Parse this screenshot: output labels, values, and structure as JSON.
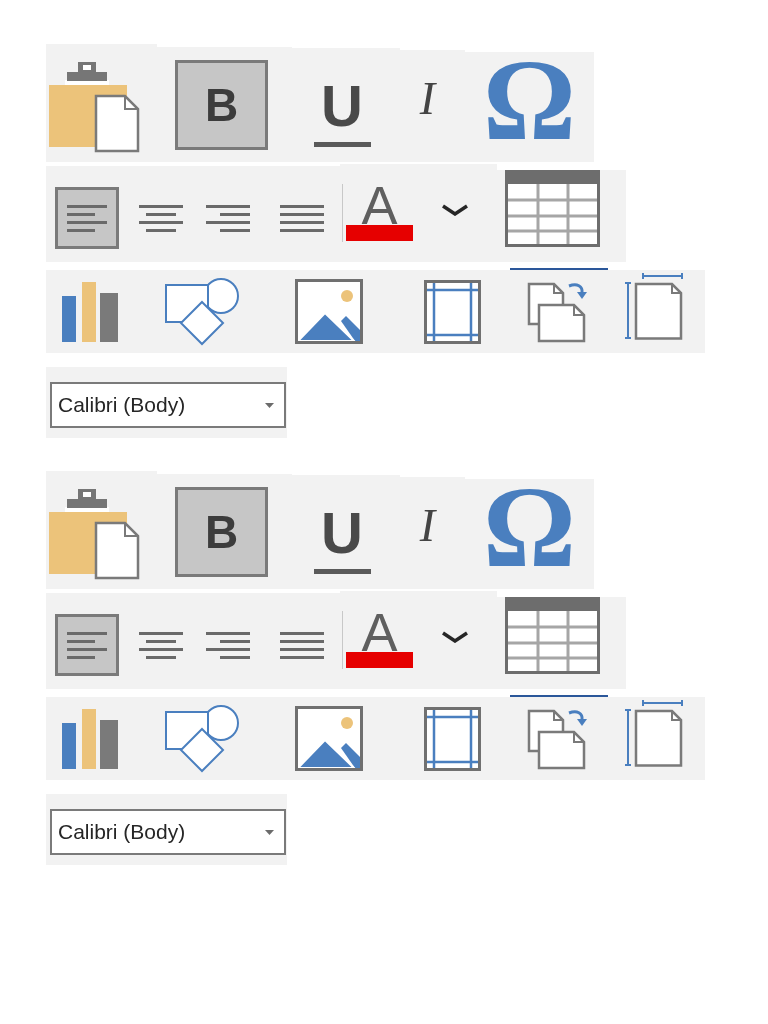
{
  "toolbars": [
    {
      "clipboard_row": [
        {
          "kind": "paste"
        },
        {
          "kind": "bold",
          "label": "B",
          "selected": true
        },
        {
          "kind": "underline",
          "label": "U",
          "selected": false
        },
        {
          "kind": "italic",
          "label": "I",
          "selected": false
        },
        {
          "kind": "symbol",
          "label": "Ω"
        }
      ],
      "paragraph_row": [
        {
          "kind": "align_left",
          "selected": true
        },
        {
          "kind": "align_center",
          "selected": false
        },
        {
          "kind": "align_right",
          "selected": false
        },
        {
          "kind": "justify",
          "selected": false
        },
        {
          "kind": "font_color",
          "label": "A",
          "color": "#e60000"
        },
        {
          "kind": "dropdown"
        },
        {
          "kind": "table"
        }
      ],
      "insert_row": [
        {
          "kind": "chart",
          "selected": false
        },
        {
          "kind": "shapes",
          "selected": false
        },
        {
          "kind": "picture",
          "selected": false
        },
        {
          "kind": "margins",
          "selected": false
        },
        {
          "kind": "pages",
          "selected": true
        },
        {
          "kind": "page_size",
          "selected": false
        }
      ],
      "font_select": {
        "value": "Calibri (Body)"
      }
    },
    {
      "clipboard_row": [
        {
          "kind": "paste"
        },
        {
          "kind": "bold",
          "label": "B",
          "selected": true
        },
        {
          "kind": "underline",
          "label": "U",
          "selected": false
        },
        {
          "kind": "italic",
          "label": "I",
          "selected": false
        },
        {
          "kind": "symbol",
          "label": "Ω"
        }
      ],
      "paragraph_row": [
        {
          "kind": "align_left",
          "selected": true
        },
        {
          "kind": "align_center",
          "selected": false
        },
        {
          "kind": "align_right",
          "selected": false
        },
        {
          "kind": "justify",
          "selected": false
        },
        {
          "kind": "font_color",
          "label": "A",
          "color": "#e60000"
        },
        {
          "kind": "dropdown"
        },
        {
          "kind": "table"
        }
      ],
      "insert_row": [
        {
          "kind": "chart",
          "selected": false
        },
        {
          "kind": "shapes",
          "selected": false
        },
        {
          "kind": "picture",
          "selected": false
        },
        {
          "kind": "margins",
          "selected": false
        },
        {
          "kind": "pages",
          "selected": true
        },
        {
          "kind": "page_size",
          "selected": false
        }
      ],
      "font_select": {
        "value": "Calibri (Body)"
      }
    }
  ]
}
